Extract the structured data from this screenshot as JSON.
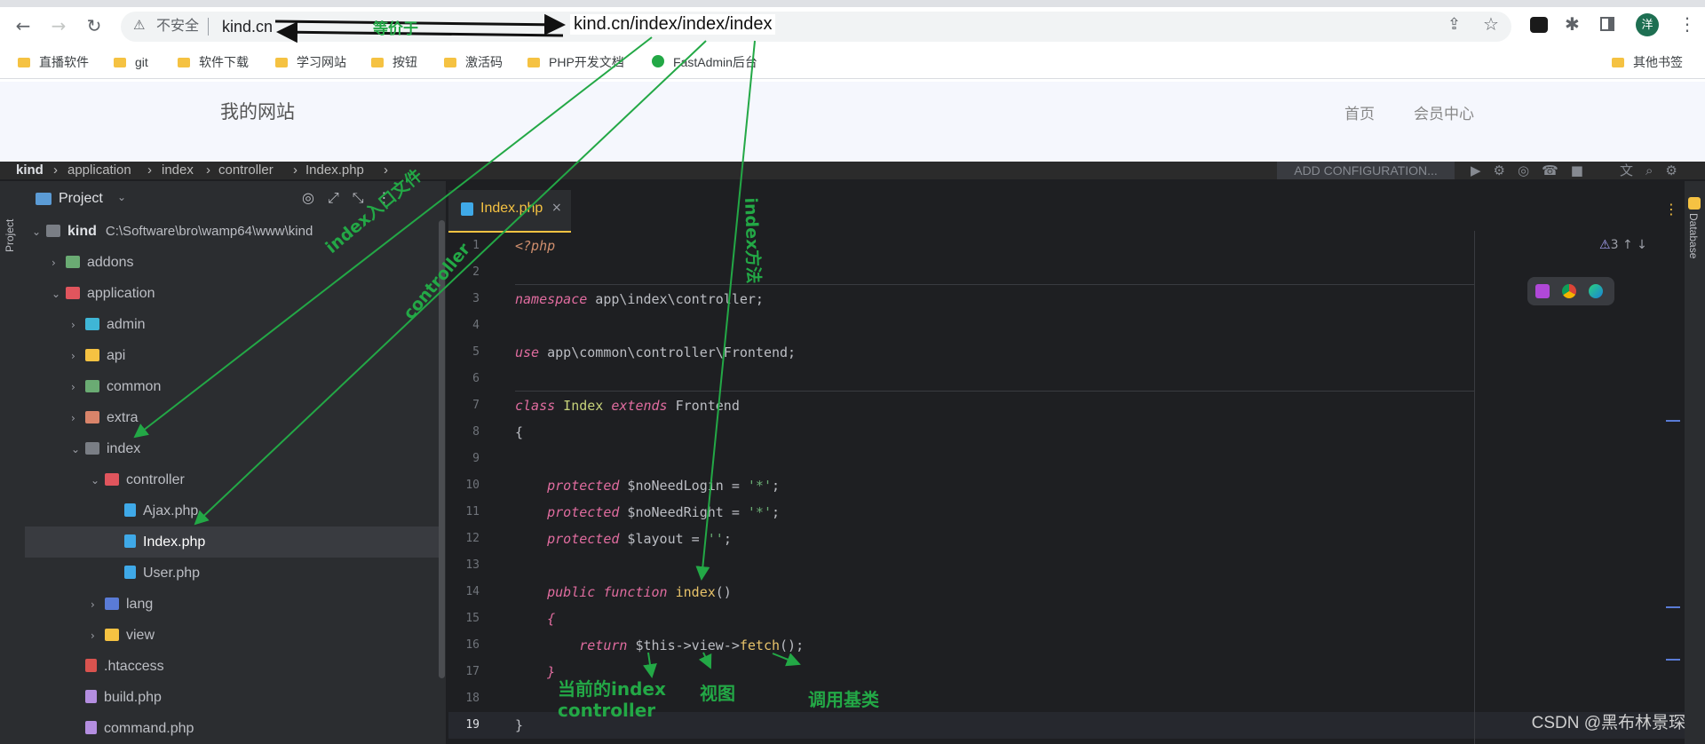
{
  "browser": {
    "insecure_label": "不安全",
    "url": "kind.cn",
    "url_full_annotation": "kind.cn/index/index/index",
    "profile_initial": "洋",
    "bookmarks": [
      "直播软件",
      "git",
      "软件下载",
      "学习网站",
      "按钮",
      "激活码",
      "PHP开发文档",
      "FastAdmin后台"
    ],
    "other_bookmarks": "其他书签"
  },
  "site": {
    "title": "我的网站",
    "nav": [
      "首页",
      "会员中心"
    ]
  },
  "ide": {
    "breadcrumb": [
      "kind",
      "application",
      "index",
      "controller",
      "Index.php"
    ],
    "run_config": "ADD CONFIGURATION...",
    "panel_title": "Project",
    "side_label": "Project",
    "right_label": "Database",
    "root_name": "kind",
    "root_path": "C:\\Software\\bro\\wamp64\\www\\kind",
    "tree": [
      {
        "label": "addons",
        "depth": 1,
        "chev": "›",
        "color": "#6aab73"
      },
      {
        "label": "application",
        "depth": 1,
        "chev": "⌄",
        "color": "#e0555d"
      },
      {
        "label": "admin",
        "depth": 2,
        "chev": "›",
        "color": "#3fb6d6"
      },
      {
        "label": "api",
        "depth": 2,
        "chev": "›",
        "color": "#f5c242"
      },
      {
        "label": "common",
        "depth": 2,
        "chev": "›",
        "color": "#6aab73"
      },
      {
        "label": "extra",
        "depth": 2,
        "chev": "›",
        "color": "#d9846a"
      },
      {
        "label": "index",
        "depth": 2,
        "chev": "⌄",
        "color": "#7a7e85"
      },
      {
        "label": "controller",
        "depth": 3,
        "chev": "⌄",
        "color": "#e0555d"
      },
      {
        "label": "Ajax.php",
        "depth": 4,
        "chev": "",
        "color": "#3fa9e8"
      },
      {
        "label": "Index.php",
        "depth": 4,
        "chev": "",
        "color": "#3fa9e8"
      },
      {
        "label": "User.php",
        "depth": 4,
        "chev": "",
        "color": "#3fa9e8"
      },
      {
        "label": "lang",
        "depth": 3,
        "chev": "›",
        "color": "#5a7bd6"
      },
      {
        "label": "view",
        "depth": 3,
        "chev": "›",
        "color": "#f5c242"
      },
      {
        "label": ".htaccess",
        "depth": 2,
        "chev": "",
        "color": "#d9534f"
      },
      {
        "label": "build.php",
        "depth": 2,
        "chev": "",
        "color": "#b48ee0"
      },
      {
        "label": "command.php",
        "depth": 2,
        "chev": "",
        "color": "#b48ee0"
      }
    ],
    "tab_label": "Index.php",
    "warnings": "3",
    "line_numbers": [
      "1",
      "2",
      "3",
      "4",
      "5",
      "6",
      "7",
      "8",
      "9",
      "10",
      "11",
      "12",
      "13",
      "14",
      "15",
      "16",
      "17",
      "18",
      "19"
    ],
    "code": {
      "l1": "<?php",
      "l3_kw": "namespace",
      "l3_rest": " app\\index\\controller;",
      "l5_kw": "use",
      "l5_rest": " app\\common\\controller\\Frontend;",
      "l7_kw": "class",
      "l7_name": " Index",
      "l7_kw2": " extends",
      "l7_rest": " Frontend",
      "l8": "{",
      "l10_kw": "    protected",
      "l10_rest": " $noNeedLogin = ",
      "l10_str": "'*'",
      "l11_kw": "    protected",
      "l11_rest": " $noNeedRight = ",
      "l11_str": "'*'",
      "l12_kw": "    protected",
      "l12_rest": " $layout = ",
      "l12_str": "''",
      "l14_kw": "    public function",
      "l14_fn": " index",
      "l14_rest": "()",
      "l15": "    {",
      "l16_kw": "        return",
      "l16_rest": " $this->view->",
      "l16_fn": "fetch",
      "l16_end": "();",
      "l17": "    }",
      "l19": "}",
      "semi": ";"
    }
  },
  "annotations": {
    "same_as": "等价于",
    "entry_file": "index入口文件",
    "controller": "controller",
    "method": "index方法",
    "current_controller_1": "当前的index",
    "current_controller_2": "controller",
    "view": "视图",
    "base_class": "调用基类"
  },
  "watermark": "CSDN @黑布林景琛"
}
